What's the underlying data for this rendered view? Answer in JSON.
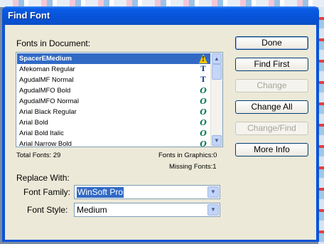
{
  "window": {
    "title": "Find Font"
  },
  "fonts_section": {
    "label": "Fonts in Document:",
    "items": [
      {
        "name": "SpacerEMedium",
        "icon": "warning-icon",
        "selected": true
      },
      {
        "name": "Afekoman Regular",
        "icon": "truetype-icon"
      },
      {
        "name": "AgudalMF Normal",
        "icon": "truetype-icon"
      },
      {
        "name": "AgudalMFO Bold",
        "icon": "opentype-icon"
      },
      {
        "name": "AgudalMFO Normal",
        "icon": "opentype-icon"
      },
      {
        "name": "Arial Black Regular",
        "icon": "opentype-icon"
      },
      {
        "name": "Arial Bold",
        "icon": "opentype-icon"
      },
      {
        "name": "Arial Bold Italic",
        "icon": "opentype-icon"
      },
      {
        "name": "Arial Narrow Bold",
        "icon": "opentype-icon"
      }
    ],
    "total_fonts": "Total Fonts: 29",
    "fonts_in_graphics": "Fonts in Graphics:0",
    "missing_fonts": "Missing Fonts:1"
  },
  "replace": {
    "label": "Replace With:",
    "font_family_label": "Font Family:",
    "font_family_value": "WinSoft Pro",
    "font_style_label": "Font Style:",
    "font_style_value": "Medium"
  },
  "buttons": {
    "done": "Done",
    "find_first": "Find First",
    "change": "Change",
    "change_all": "Change All",
    "change_find": "Change/Find",
    "more_info": "More Info"
  },
  "colors": {
    "title_bar": "#0a53d8",
    "selection": "#316ac5",
    "dialog_bg": "#ece9d8"
  }
}
